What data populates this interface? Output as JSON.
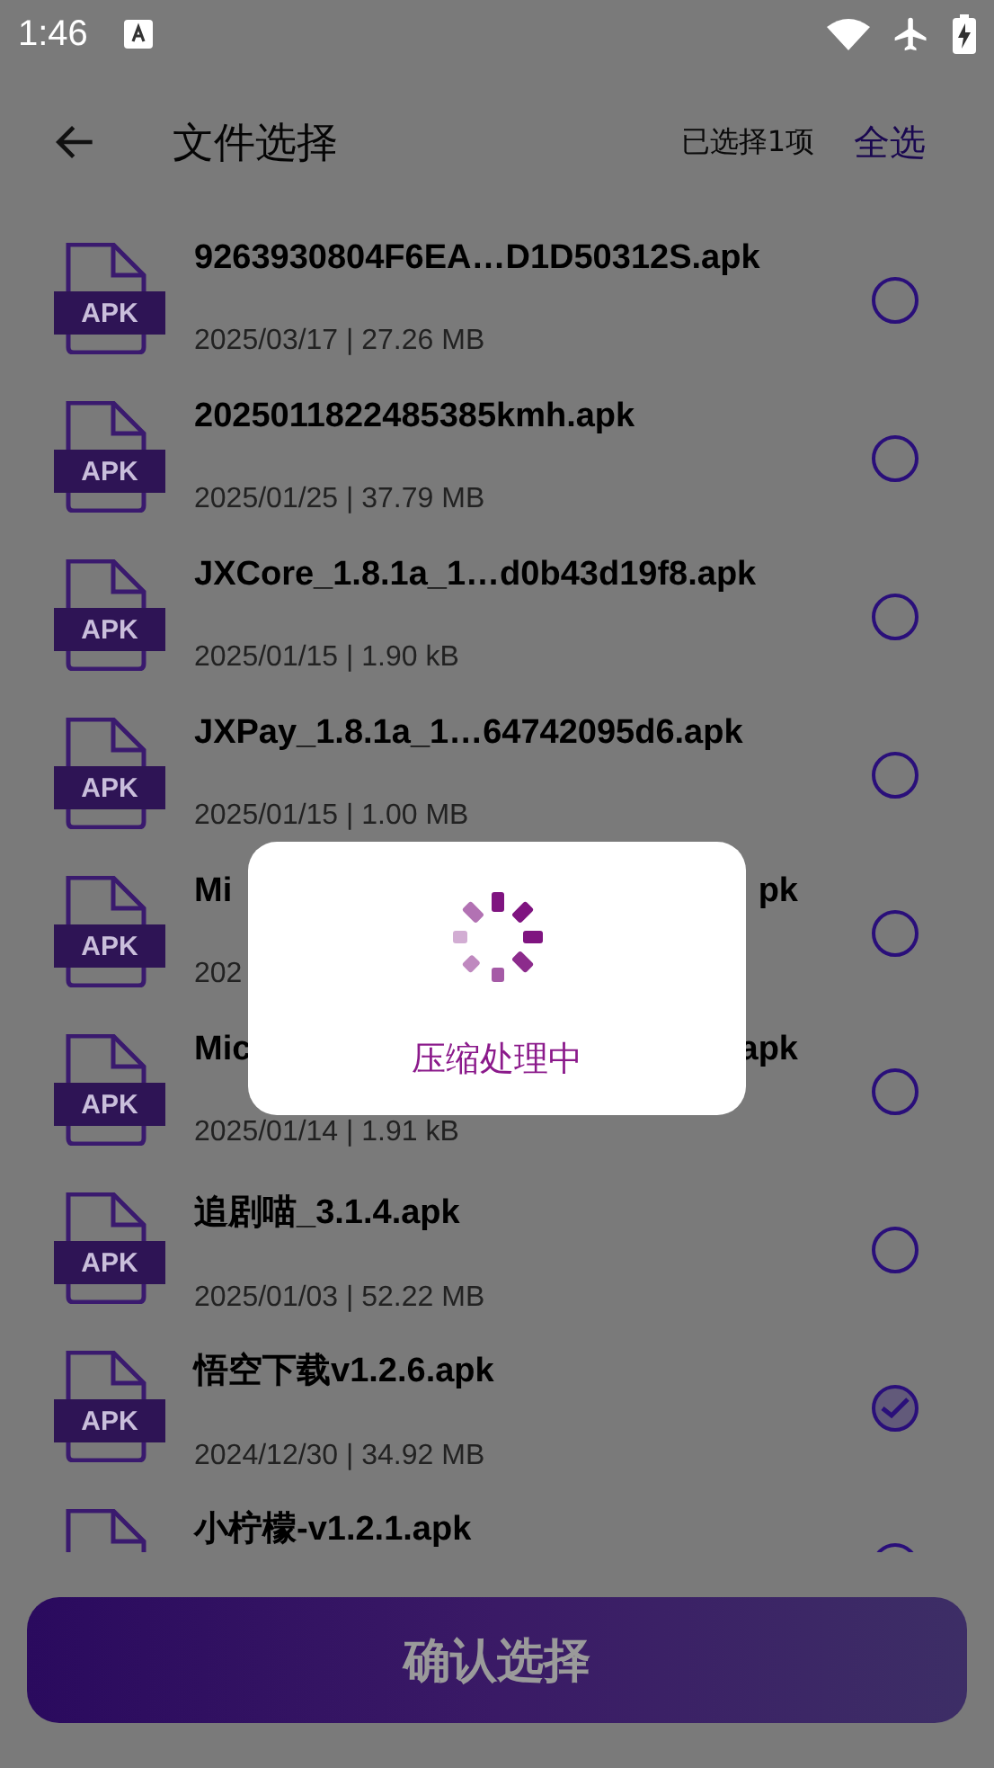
{
  "status_bar": {
    "time": "1:46"
  },
  "header": {
    "title": "文件选择",
    "selected_count": "已选择1项",
    "select_all": "全选"
  },
  "files": [
    {
      "kind": "full",
      "name": "9263930804F6EA…D1D50312S.apk",
      "meta": "2025/03/17 | 27.26 MB",
      "badge": "APK",
      "selected": false
    },
    {
      "kind": "full",
      "name": "2025011822485385kmh.apk",
      "meta": "2025/01/25 | 37.79 MB",
      "badge": "APK",
      "selected": false
    },
    {
      "kind": "full",
      "name": "JXCore_1.8.1a_1…d0b43d19f8.apk",
      "meta": "2025/01/15 | 1.90 kB",
      "badge": "APK",
      "selected": false
    },
    {
      "kind": "full",
      "name": "JXPay_1.8.1a_1…64742095d6.apk",
      "meta": "2025/01/15 | 1.00 MB",
      "badge": "APK",
      "selected": false
    },
    {
      "kind": "split",
      "name_start": "Mi",
      "name_end": "pk",
      "meta": "202",
      "badge": "APK",
      "selected": false
    },
    {
      "kind": "split",
      "name_start": "Mic",
      "name_end": "apk",
      "meta": "2025/01/14 | 1.91 kB",
      "badge": "APK",
      "selected": false
    },
    {
      "kind": "full",
      "name": "追剧喵_3.1.4.apk",
      "meta": "2025/01/03 | 52.22 MB",
      "badge": "APK",
      "selected": false
    },
    {
      "kind": "full",
      "name": "悟空下载v1.2.6.apk",
      "meta": "2024/12/30 | 34.92 MB",
      "badge": "APK",
      "selected": true
    },
    {
      "kind": "full",
      "name": "小柠檬-v1.2.1.apk",
      "selected": false
    }
  ],
  "dialog": {
    "message": "压缩处理中"
  },
  "confirm_button": "确认选择"
}
